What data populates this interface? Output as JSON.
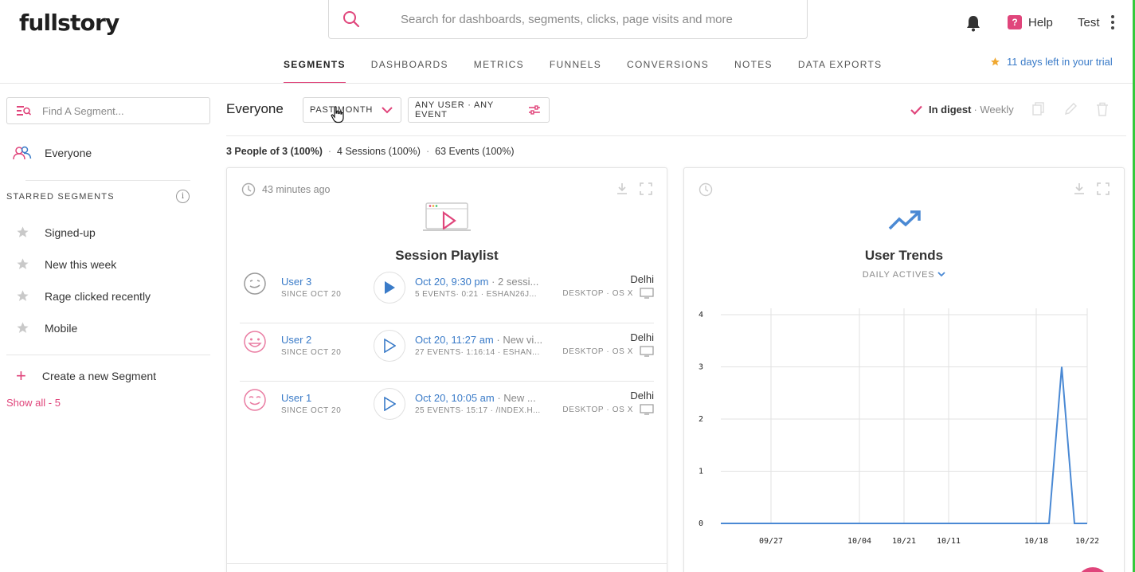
{
  "header": {
    "logo": "fullstory",
    "search_placeholder": "Search for dashboards, segments, clicks, page visits and more",
    "help": "Help",
    "user": "Test"
  },
  "nav": {
    "tabs": [
      "SEGMENTS",
      "DASHBOARDS",
      "METRICS",
      "FUNNELS",
      "CONVERSIONS",
      "NOTES",
      "DATA EXPORTS"
    ],
    "active": "SEGMENTS"
  },
  "trial": "11 days left in your trial",
  "sidebar": {
    "find_placeholder": "Find A Segment...",
    "everyone": "Everyone",
    "starred_title": "STARRED SEGMENTS",
    "info": "i",
    "starred": [
      "Signed-up",
      "New this week",
      "Rage clicked recently",
      "Mobile"
    ],
    "create": "Create a new Segment",
    "show_all": "Show all - 5"
  },
  "toolbar": {
    "title": "Everyone",
    "time_filter": "PAST MONTH",
    "user_filter": "ANY USER · ANY EVENT",
    "digest": "In digest",
    "digest_freq": "· Weekly"
  },
  "stats": {
    "people": "3 People of 3 (100%)",
    "sessions": "4 Sessions (100%)",
    "events": "63 Events (100%)",
    "sep": "·"
  },
  "playlist": {
    "time": "43 minutes ago",
    "title": "Session Playlist",
    "sessions": [
      {
        "user": "User 3",
        "since": "SINCE OCT 20",
        "date": "Oct 20, 9:30 pm",
        "rest": " · 2 sessi...",
        "events": "5 EVENTS· 0:21 · ESHAN26J...",
        "city": "Delhi",
        "device": "DESKTOP · OS X"
      },
      {
        "user": "User 2",
        "since": "SINCE OCT 20",
        "date": "Oct 20, 11:27 am",
        "rest": " · New vi...",
        "events": "27 EVENTS· 1:16:14 · ESHAN...",
        "city": "Delhi",
        "device": "DESKTOP · OS X"
      },
      {
        "user": "User 1",
        "since": "SINCE OCT 20",
        "date": "Oct 20, 10:05 am",
        "rest": " · New ...",
        "events": "25 EVENTS· 15:17 · /INDEX.H...",
        "city": "Delhi",
        "device": "DESKTOP · OS X"
      }
    ]
  },
  "trends": {
    "title": "User Trends",
    "subtitle": "DAILY ACTIVES"
  },
  "chart_data": {
    "type": "line",
    "x": [
      "09/21",
      "09/27",
      "10/04",
      "10/21",
      "10/11",
      "10/18",
      "10/19",
      "10/20",
      "10/21",
      "10/22"
    ],
    "x_tick_labels": [
      "09/27",
      "10/04",
      "10/21",
      "10/11",
      "10/18",
      "10/22"
    ],
    "series": [
      {
        "values": [
          0,
          0,
          0,
          0,
          0,
          0,
          0,
          3,
          0,
          0
        ]
      }
    ],
    "ylim": [
      0,
      4
    ],
    "yticks": [
      0,
      1,
      2,
      3,
      4
    ],
    "grid": true,
    "color": "#4a89d4"
  },
  "colors": {
    "accent": "#e0457b",
    "link": "#3a7bc8",
    "star": "#f0a830"
  }
}
